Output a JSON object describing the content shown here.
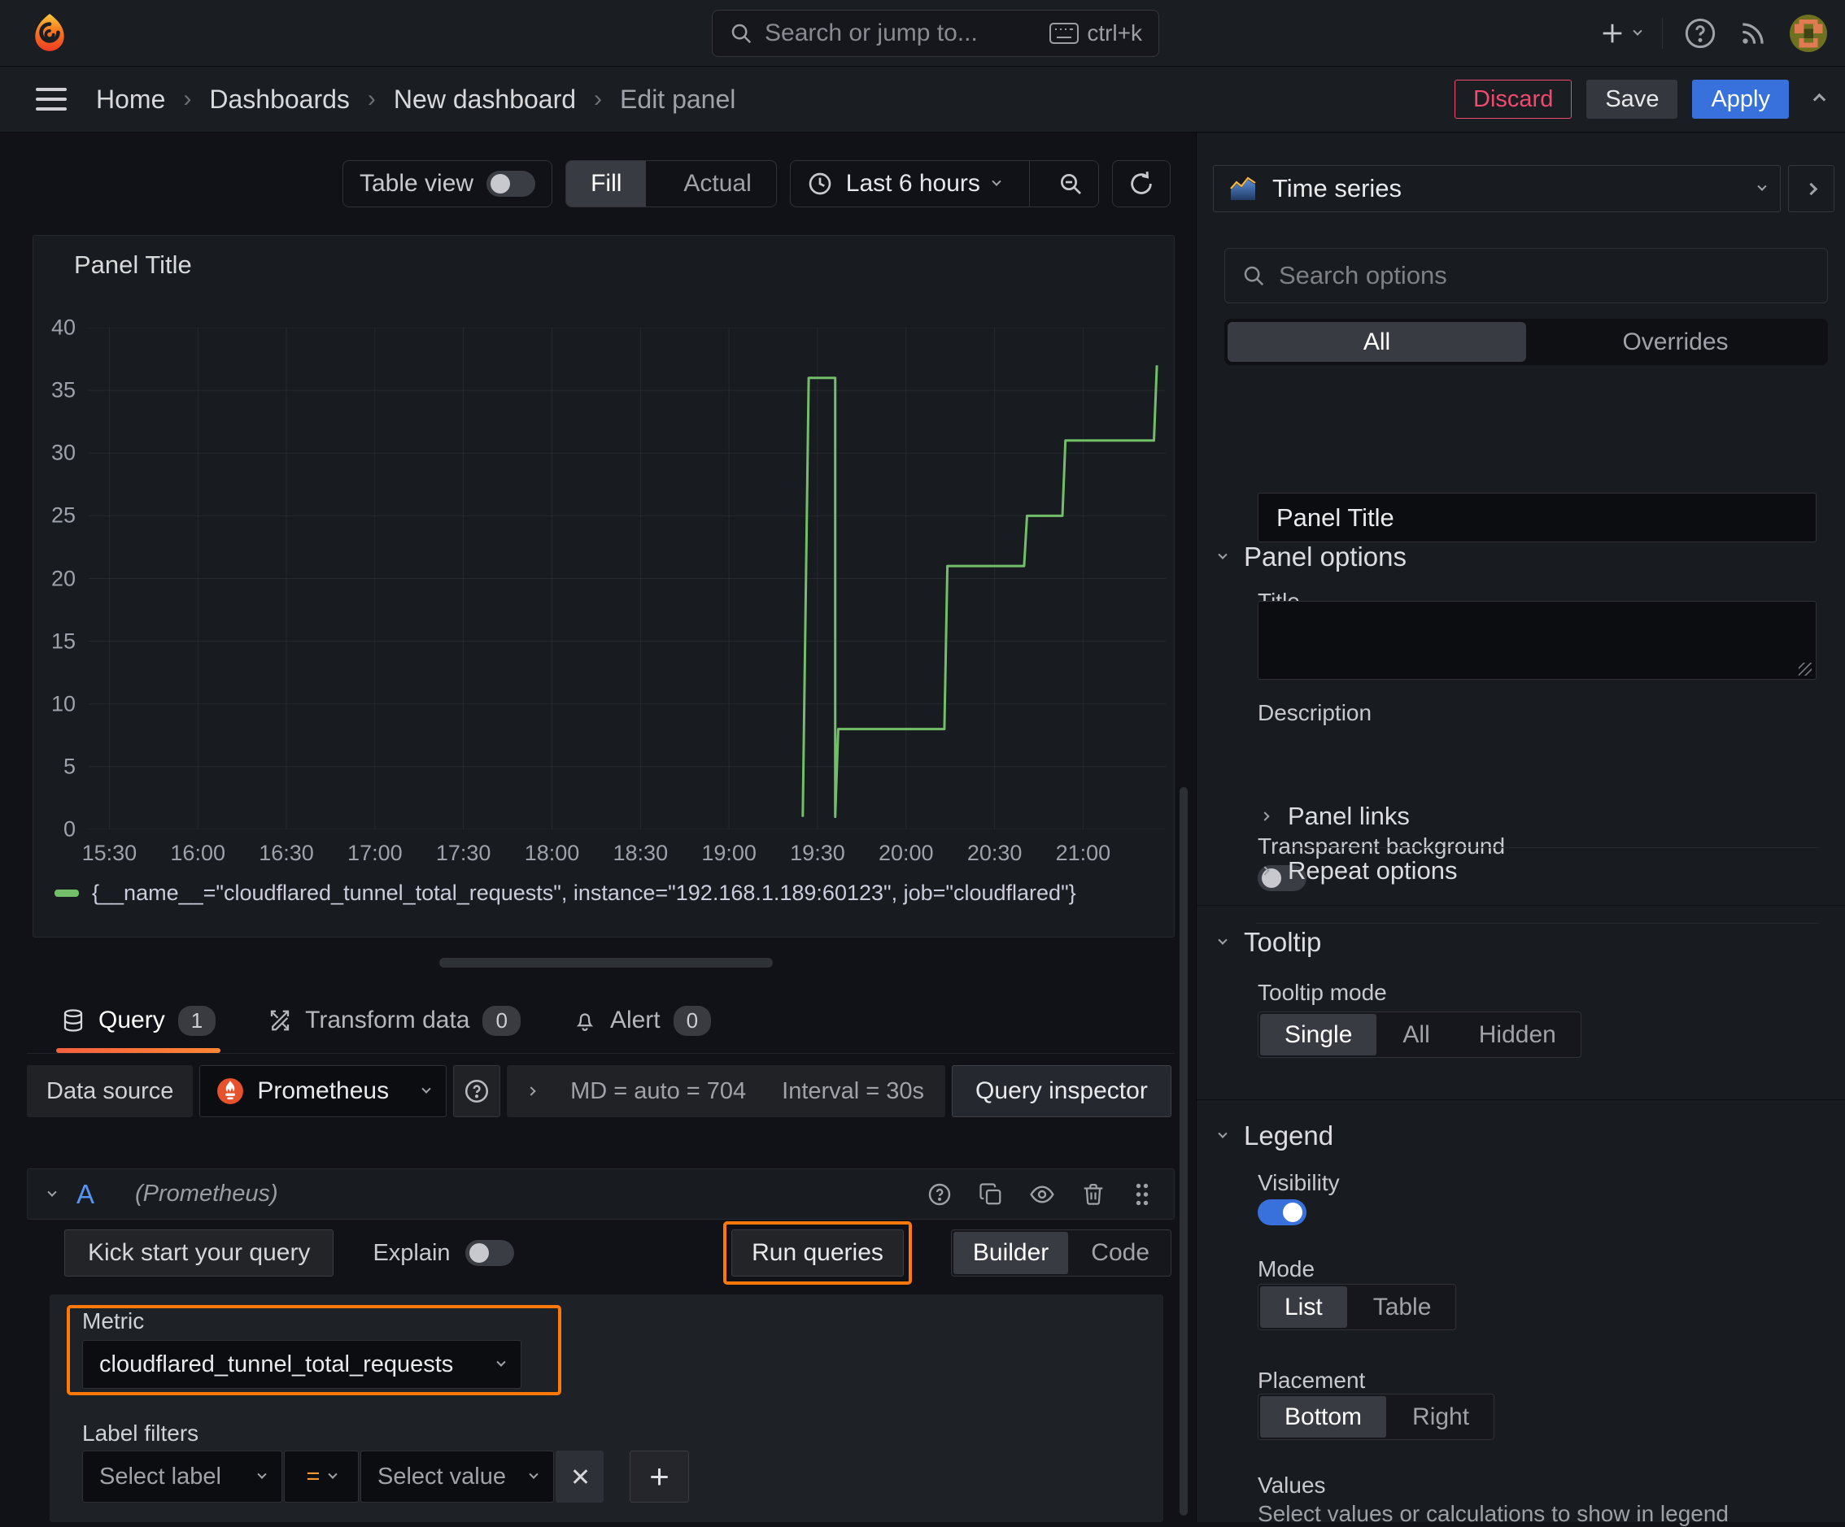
{
  "topnav": {
    "search_placeholder": "Search or jump to...",
    "shortcut": "ctrl+k"
  },
  "breadcrumb": {
    "home": "Home",
    "dashboards": "Dashboards",
    "new_dashboard": "New dashboard",
    "edit_panel": "Edit panel"
  },
  "actions": {
    "discard": "Discard",
    "save": "Save",
    "apply": "Apply"
  },
  "toolbar": {
    "table_view": "Table view",
    "fill": "Fill",
    "actual": "Actual",
    "time_range": "Last 6 hours"
  },
  "panel": {
    "title": "Panel Title"
  },
  "chart_data": {
    "type": "line",
    "title": "Panel Title",
    "line_style": "step",
    "grid": true,
    "legend_position": "bottom",
    "x_domain": [
      "15:23",
      "21:28"
    ],
    "ylim": [
      0,
      40
    ],
    "yticks": [
      0,
      5,
      10,
      15,
      20,
      25,
      30,
      35,
      40
    ],
    "xticks": [
      "15:30",
      "16:00",
      "16:30",
      "17:00",
      "17:30",
      "18:00",
      "18:30",
      "19:00",
      "19:30",
      "20:00",
      "20:30",
      "21:00"
    ],
    "series": [
      {
        "name": "{__name__=\"cloudflared_tunnel_total_requests\", instance=\"192.168.1.189:60123\", job=\"cloudflared\"}",
        "color": "#73bf69",
        "points": [
          [
            "19:25",
            1
          ],
          [
            "19:27",
            36
          ],
          [
            "19:36",
            36
          ],
          [
            "19:36",
            1
          ],
          [
            "19:37",
            8
          ],
          [
            "20:13",
            8
          ],
          [
            "20:14",
            21
          ],
          [
            "20:40",
            21
          ],
          [
            "20:41",
            25
          ],
          [
            "20:53",
            25
          ],
          [
            "20:54",
            31
          ],
          [
            "21:24",
            31
          ],
          [
            "21:25",
            37
          ]
        ]
      }
    ]
  },
  "query_section": {
    "tabs": [
      {
        "label": "Query",
        "badge": "1"
      },
      {
        "label": "Transform data",
        "badge": "0"
      },
      {
        "label": "Alert",
        "badge": "0"
      }
    ],
    "datasource": {
      "label": "Data source",
      "name": "Prometheus",
      "md_stat": "MD = auto = 704",
      "interval_stat": "Interval = 30s",
      "inspector": "Query inspector"
    },
    "query_row": {
      "ref_id": "A",
      "ds_hint": "(Prometheus)"
    },
    "controls": {
      "kickstart": "Kick start your query",
      "explain": "Explain",
      "run": "Run queries",
      "builder": "Builder",
      "code": "Code"
    },
    "builder": {
      "metric_label": "Metric",
      "metric_value": "cloudflared_tunnel_total_requests",
      "label_filters": "Label filters",
      "select_label": "Select label",
      "operator": "=",
      "select_value": "Select value"
    }
  },
  "options": {
    "viz_name": "Time series",
    "search_placeholder": "Search options",
    "tab_all": "All",
    "tab_overrides": "Overrides",
    "panel_options": {
      "header": "Panel options",
      "title_label": "Title",
      "title_value": "Panel Title",
      "description_label": "Description",
      "transparent": "Transparent background"
    },
    "links": "Panel links",
    "repeat": "Repeat options",
    "tooltip": {
      "header": "Tooltip",
      "mode_label": "Tooltip mode",
      "single": "Single",
      "all": "All",
      "hidden": "Hidden"
    },
    "legend": {
      "header": "Legend",
      "visibility": "Visibility",
      "mode": "Mode",
      "list": "List",
      "table": "Table",
      "placement": "Placement",
      "bottom": "Bottom",
      "right": "Right",
      "values": "Values",
      "values_desc": "Select values or calculations to show in legend"
    }
  },
  "colors": {
    "annotation_orange": "#ff780a",
    "series_green": "#73bf69",
    "primary_blue": "#3871dc",
    "destructive_red": "#f04a6e"
  }
}
